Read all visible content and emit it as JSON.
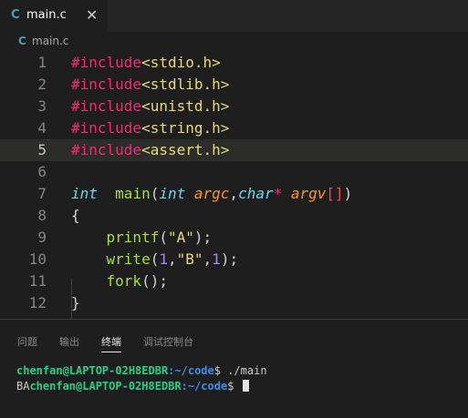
{
  "tab": {
    "icon": "c-language-icon",
    "icon_text": "C",
    "label": "main.c",
    "close": "✕"
  },
  "breadcrumb": {
    "icon": "c-language-icon",
    "icon_text": "C",
    "label": "main.c"
  },
  "editor": {
    "active_line": 5,
    "lines": [
      {
        "num": "1",
        "tokens": [
          [
            "inc",
            "#include"
          ],
          [
            "hdr",
            "<stdio.h>"
          ]
        ]
      },
      {
        "num": "2",
        "tokens": [
          [
            "inc",
            "#include"
          ],
          [
            "hdr",
            "<stdlib.h>"
          ]
        ]
      },
      {
        "num": "3",
        "tokens": [
          [
            "inc",
            "#include"
          ],
          [
            "hdr",
            "<unistd.h>"
          ]
        ]
      },
      {
        "num": "4",
        "tokens": [
          [
            "inc",
            "#include"
          ],
          [
            "hdr",
            "<string.h>"
          ]
        ]
      },
      {
        "num": "5",
        "tokens": [
          [
            "inc",
            "#include"
          ],
          [
            "hdr",
            "<assert.h>"
          ]
        ]
      },
      {
        "num": "6",
        "tokens": []
      },
      {
        "num": "7",
        "tokens": [
          [
            "kw",
            "int"
          ],
          [
            "",
            "  "
          ],
          [
            "fn",
            "main"
          ],
          [
            "",
            "("
          ],
          [
            "kw",
            "int"
          ],
          [
            "",
            " "
          ],
          [
            "par",
            "argc"
          ],
          [
            "",
            ","
          ],
          [
            "kw",
            "char"
          ],
          [
            "op",
            "*"
          ],
          [
            "",
            " "
          ],
          [
            "par",
            "argv"
          ],
          [
            "brk",
            "[]"
          ],
          [
            "",
            ")"
          ]
        ]
      },
      {
        "num": "8",
        "tokens": [
          [
            "",
            "{"
          ]
        ]
      },
      {
        "num": "9",
        "tokens": [
          [
            "",
            "    "
          ],
          [
            "fn",
            "printf"
          ],
          [
            "",
            "("
          ],
          [
            "str",
            "\"A\""
          ],
          [
            "",
            ");"
          ]
        ]
      },
      {
        "num": "10",
        "tokens": [
          [
            "",
            "    "
          ],
          [
            "fn",
            "write"
          ],
          [
            "",
            "("
          ],
          [
            "num",
            "1"
          ],
          [
            "",
            ","
          ],
          [
            "str",
            "\"B\""
          ],
          [
            "",
            ","
          ],
          [
            "num",
            "1"
          ],
          [
            "",
            ");"
          ]
        ]
      },
      {
        "num": "11",
        "tokens": [
          [
            "",
            "    "
          ],
          [
            "fn",
            "fork"
          ],
          [
            "",
            "();"
          ]
        ]
      },
      {
        "num": "12",
        "tokens": [
          [
            "",
            "}"
          ]
        ]
      }
    ]
  },
  "panel": {
    "tabs": [
      "问题",
      "输出",
      "终端",
      "调试控制台"
    ],
    "active_tab": 2,
    "terminal": {
      "line1": {
        "user": "chenfan@LAPTOP-02H8EDBR",
        "path": ":~/code",
        "suffix": "$ ./main"
      },
      "line2": {
        "prefix": "BA",
        "user": "chenfan@LAPTOP-02H8EDBR",
        "path": ":~/code",
        "suffix": "$ "
      }
    }
  },
  "colors": {
    "editor_bg": "#1e1e1e",
    "tabbar_bg": "#252526",
    "c_icon": "#519aba",
    "include": "#f92672",
    "header": "#e6db74",
    "keyword": "#66d9ef",
    "function": "#a6e22e",
    "param": "#fd971f",
    "number": "#ae81ff",
    "terminal_user": "#23d18b",
    "terminal_path": "#3b8eea"
  }
}
